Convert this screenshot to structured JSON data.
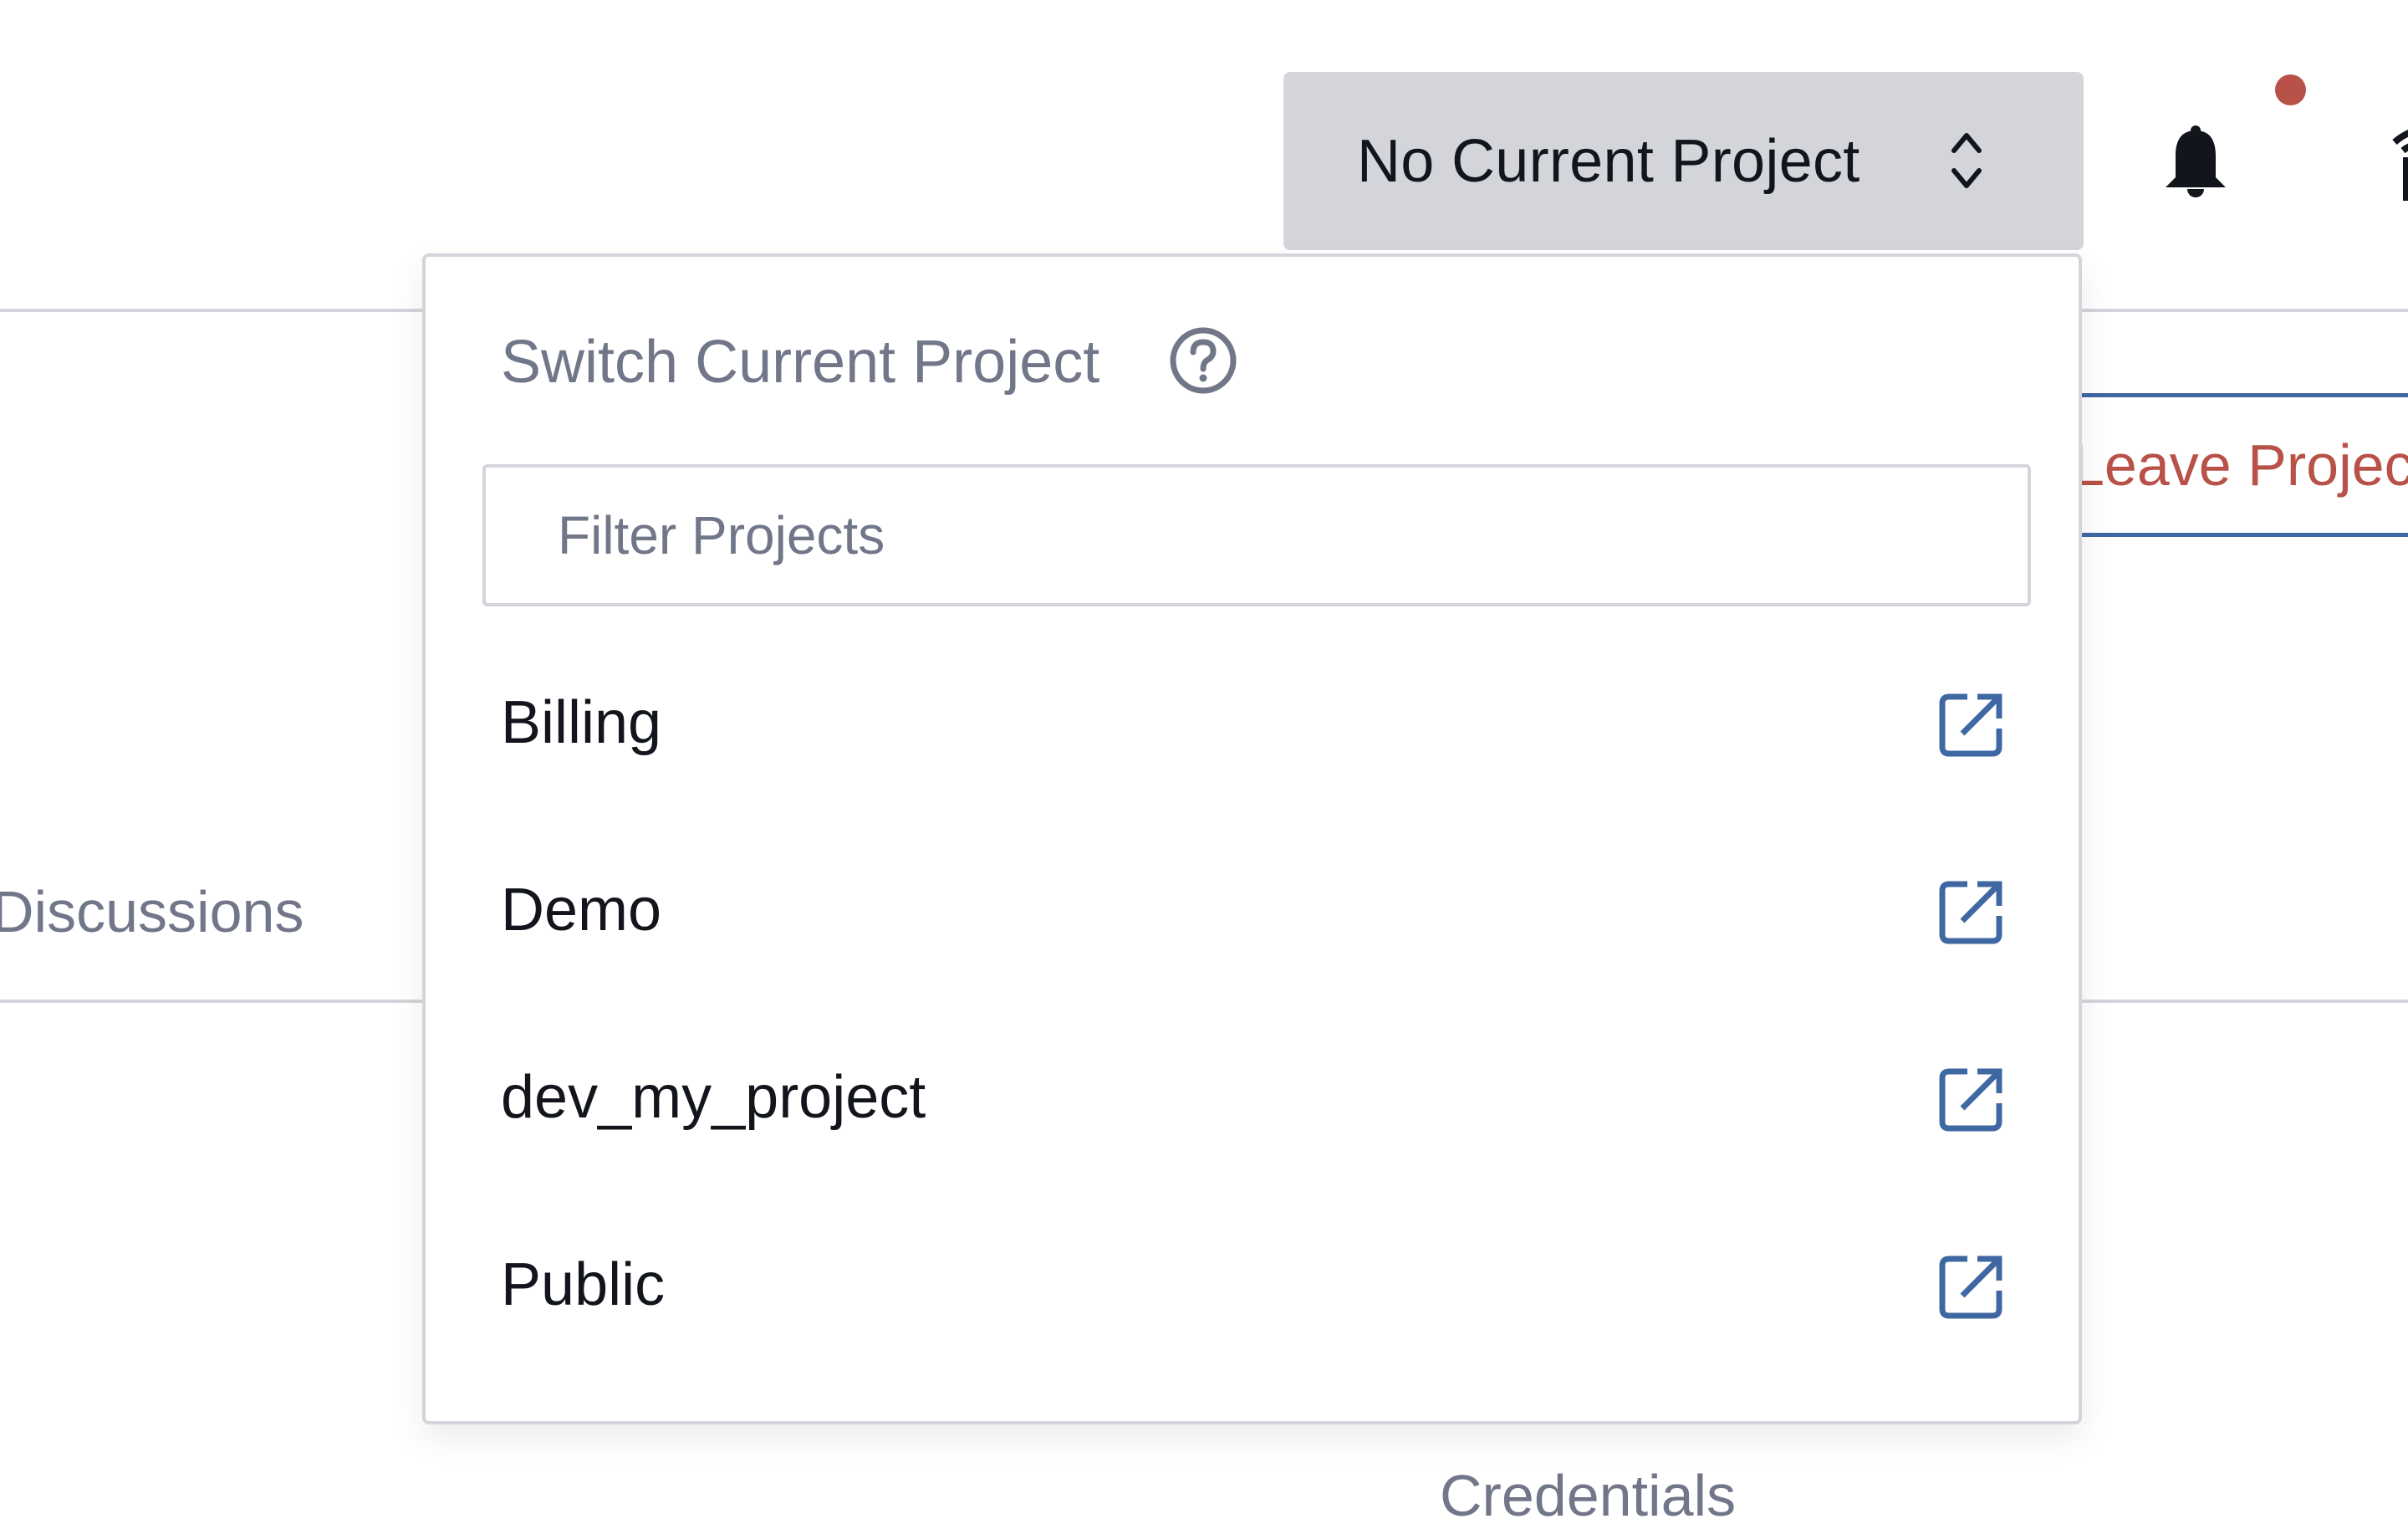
{
  "header": {
    "project_switcher_label": "No Current Project",
    "project_switcher_icon": "chevron-up-down-icon",
    "notifications_icon": "bell-icon",
    "notification_dot_color": "#b85147",
    "partial_icon": "partially-visible-icon"
  },
  "background": {
    "leave_project_label": "Leave Project",
    "tab_discussions_label": "Discussions",
    "credentials_label": "Credentials"
  },
  "dropdown": {
    "title": "Switch Current Project",
    "help_icon": "question-circle-icon",
    "filter": {
      "value": "",
      "placeholder": "Filter Projects"
    },
    "projects": [
      {
        "name": "Billing",
        "icon": "external-link-icon"
      },
      {
        "name": "Demo",
        "icon": "external-link-icon"
      },
      {
        "name": "dev_my_project",
        "icon": "external-link-icon"
      },
      {
        "name": "Public",
        "icon": "external-link-icon"
      }
    ]
  },
  "colors": {
    "accent_blue": "#3f68a3",
    "danger_red": "#b85147",
    "muted_text": "#727689",
    "text": "#12151b",
    "border": "#d4d5da"
  }
}
